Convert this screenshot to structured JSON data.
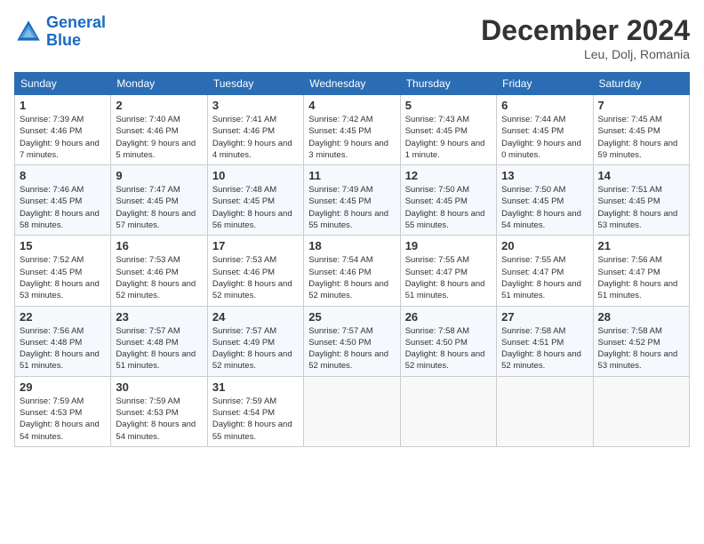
{
  "logo": {
    "line1": "General",
    "line2": "Blue"
  },
  "title": "December 2024",
  "location": "Leu, Dolj, Romania",
  "days_of_week": [
    "Sunday",
    "Monday",
    "Tuesday",
    "Wednesday",
    "Thursday",
    "Friday",
    "Saturday"
  ],
  "weeks": [
    [
      {
        "day": "1",
        "sunrise": "7:39 AM",
        "sunset": "4:46 PM",
        "daylight": "9 hours and 7 minutes."
      },
      {
        "day": "2",
        "sunrise": "7:40 AM",
        "sunset": "4:46 PM",
        "daylight": "9 hours and 5 minutes."
      },
      {
        "day": "3",
        "sunrise": "7:41 AM",
        "sunset": "4:46 PM",
        "daylight": "9 hours and 4 minutes."
      },
      {
        "day": "4",
        "sunrise": "7:42 AM",
        "sunset": "4:45 PM",
        "daylight": "9 hours and 3 minutes."
      },
      {
        "day": "5",
        "sunrise": "7:43 AM",
        "sunset": "4:45 PM",
        "daylight": "9 hours and 1 minute."
      },
      {
        "day": "6",
        "sunrise": "7:44 AM",
        "sunset": "4:45 PM",
        "daylight": "9 hours and 0 minutes."
      },
      {
        "day": "7",
        "sunrise": "7:45 AM",
        "sunset": "4:45 PM",
        "daylight": "8 hours and 59 minutes."
      }
    ],
    [
      {
        "day": "8",
        "sunrise": "7:46 AM",
        "sunset": "4:45 PM",
        "daylight": "8 hours and 58 minutes."
      },
      {
        "day": "9",
        "sunrise": "7:47 AM",
        "sunset": "4:45 PM",
        "daylight": "8 hours and 57 minutes."
      },
      {
        "day": "10",
        "sunrise": "7:48 AM",
        "sunset": "4:45 PM",
        "daylight": "8 hours and 56 minutes."
      },
      {
        "day": "11",
        "sunrise": "7:49 AM",
        "sunset": "4:45 PM",
        "daylight": "8 hours and 55 minutes."
      },
      {
        "day": "12",
        "sunrise": "7:50 AM",
        "sunset": "4:45 PM",
        "daylight": "8 hours and 55 minutes."
      },
      {
        "day": "13",
        "sunrise": "7:50 AM",
        "sunset": "4:45 PM",
        "daylight": "8 hours and 54 minutes."
      },
      {
        "day": "14",
        "sunrise": "7:51 AM",
        "sunset": "4:45 PM",
        "daylight": "8 hours and 53 minutes."
      }
    ],
    [
      {
        "day": "15",
        "sunrise": "7:52 AM",
        "sunset": "4:45 PM",
        "daylight": "8 hours and 53 minutes."
      },
      {
        "day": "16",
        "sunrise": "7:53 AM",
        "sunset": "4:46 PM",
        "daylight": "8 hours and 52 minutes."
      },
      {
        "day": "17",
        "sunrise": "7:53 AM",
        "sunset": "4:46 PM",
        "daylight": "8 hours and 52 minutes."
      },
      {
        "day": "18",
        "sunrise": "7:54 AM",
        "sunset": "4:46 PM",
        "daylight": "8 hours and 52 minutes."
      },
      {
        "day": "19",
        "sunrise": "7:55 AM",
        "sunset": "4:47 PM",
        "daylight": "8 hours and 51 minutes."
      },
      {
        "day": "20",
        "sunrise": "7:55 AM",
        "sunset": "4:47 PM",
        "daylight": "8 hours and 51 minutes."
      },
      {
        "day": "21",
        "sunrise": "7:56 AM",
        "sunset": "4:47 PM",
        "daylight": "8 hours and 51 minutes."
      }
    ],
    [
      {
        "day": "22",
        "sunrise": "7:56 AM",
        "sunset": "4:48 PM",
        "daylight": "8 hours and 51 minutes."
      },
      {
        "day": "23",
        "sunrise": "7:57 AM",
        "sunset": "4:48 PM",
        "daylight": "8 hours and 51 minutes."
      },
      {
        "day": "24",
        "sunrise": "7:57 AM",
        "sunset": "4:49 PM",
        "daylight": "8 hours and 52 minutes."
      },
      {
        "day": "25",
        "sunrise": "7:57 AM",
        "sunset": "4:50 PM",
        "daylight": "8 hours and 52 minutes."
      },
      {
        "day": "26",
        "sunrise": "7:58 AM",
        "sunset": "4:50 PM",
        "daylight": "8 hours and 52 minutes."
      },
      {
        "day": "27",
        "sunrise": "7:58 AM",
        "sunset": "4:51 PM",
        "daylight": "8 hours and 52 minutes."
      },
      {
        "day": "28",
        "sunrise": "7:58 AM",
        "sunset": "4:52 PM",
        "daylight": "8 hours and 53 minutes."
      }
    ],
    [
      {
        "day": "29",
        "sunrise": "7:59 AM",
        "sunset": "4:53 PM",
        "daylight": "8 hours and 54 minutes."
      },
      {
        "day": "30",
        "sunrise": "7:59 AM",
        "sunset": "4:53 PM",
        "daylight": "8 hours and 54 minutes."
      },
      {
        "day": "31",
        "sunrise": "7:59 AM",
        "sunset": "4:54 PM",
        "daylight": "8 hours and 55 minutes."
      },
      null,
      null,
      null,
      null
    ]
  ]
}
